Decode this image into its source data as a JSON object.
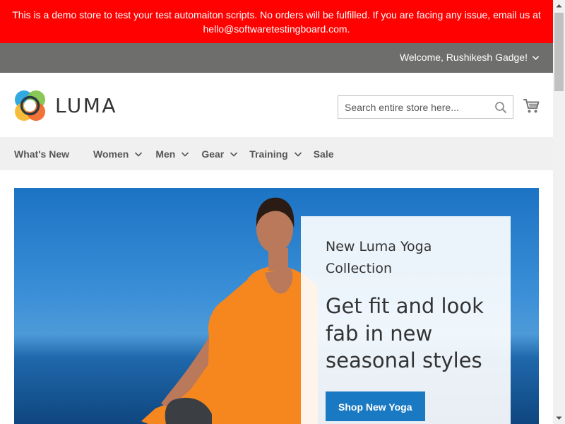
{
  "notice": {
    "text": "This is a demo store to test your test automaiton scripts. No orders will be fulfilled. If you are facing any issue, email us at hello@softwaretestingboard.com."
  },
  "header": {
    "welcome": "Welcome, Rushikesh Gadge!",
    "logo_text": "LUMA",
    "logo_icon": "luma-logo-icon",
    "search": {
      "placeholder": "Search entire store here...",
      "value": ""
    },
    "cart_icon": "cart-icon"
  },
  "nav": {
    "items": [
      {
        "label": "What's New",
        "dropdown": false
      },
      {
        "label": "Women",
        "dropdown": true
      },
      {
        "label": "Men",
        "dropdown": true
      },
      {
        "label": "Gear",
        "dropdown": true
      },
      {
        "label": "Training",
        "dropdown": true
      },
      {
        "label": "Sale",
        "dropdown": false
      }
    ]
  },
  "hero": {
    "subtitle": "New Luma Yoga Collection",
    "title": "Get fit and look fab in new seasonal styles",
    "button_label": "Shop New Yoga"
  },
  "colors": {
    "notice_bg": "#ff0101",
    "panel_bg": "#6e6e6c",
    "nav_bg": "#f0f0f0",
    "accent": "#1979c3"
  }
}
